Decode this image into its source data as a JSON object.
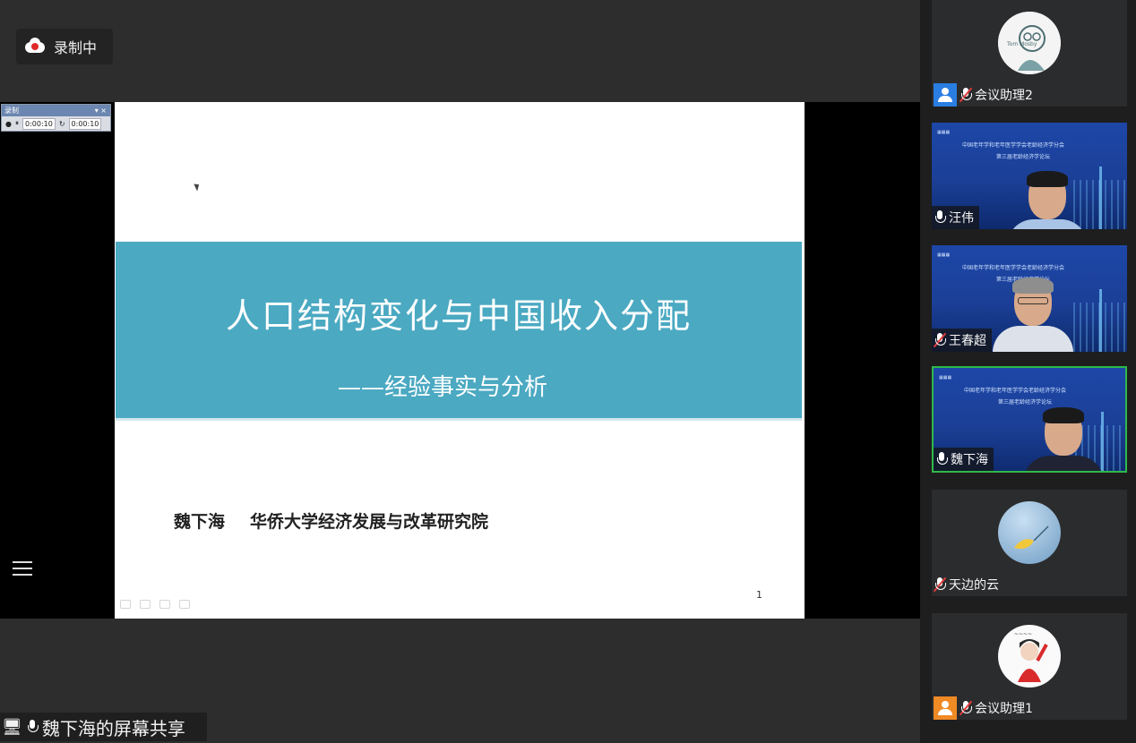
{
  "recording": {
    "label": "录制中"
  },
  "mini_recorder": {
    "title": "录制",
    "time_elapsed": "0:00:10",
    "time_total": "0:00:10"
  },
  "slide": {
    "title": "人口结构变化与中国收入分配",
    "subtitle": "——经验事实与分析",
    "author": "魏下海",
    "affiliation": "华侨大学经济发展与改革研究院",
    "page_number": "1"
  },
  "screen_share": {
    "label": "魏下海的屏幕共享"
  },
  "video_banner": {
    "line1": "中国老年学和老年医学学会老龄经济学分会",
    "line2": "第三届老龄经济学论坛"
  },
  "participants": [
    {
      "name": "会议助理2",
      "mic": "muted",
      "kind": "avatar",
      "badge": "blue",
      "avatar_text": "Tom Mosby",
      "active": false
    },
    {
      "name": "汪伟",
      "mic": "on",
      "kind": "video",
      "active": false
    },
    {
      "name": "王春超",
      "mic": "muted",
      "kind": "video",
      "active": false
    },
    {
      "name": "魏下海",
      "mic": "on",
      "kind": "video",
      "active": true
    },
    {
      "name": "天边的云",
      "mic": "muted",
      "kind": "avatar",
      "active": false
    },
    {
      "name": "会议助理1",
      "mic": "muted",
      "kind": "avatar",
      "badge": "orange",
      "active": false
    }
  ]
}
